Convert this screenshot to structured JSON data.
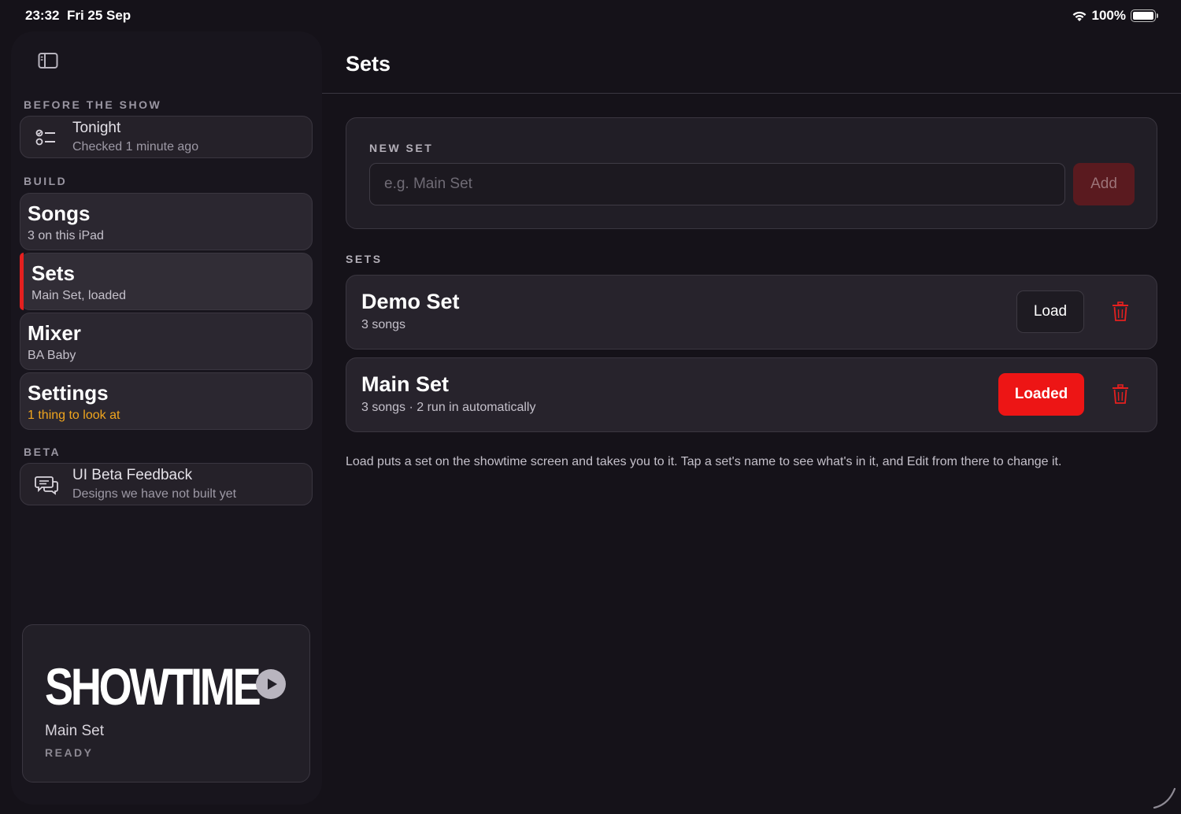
{
  "status_bar": {
    "time": "23:32",
    "date": "Fri 25 Sep",
    "battery": "100%",
    "wifi_icon": "wifi-icon",
    "battery_icon": "battery-icon"
  },
  "sidebar": {
    "toggle_icon": "sidebar-toggle-icon",
    "sections": {
      "before_show": "BEFORE THE SHOW",
      "build": "BUILD",
      "beta": "BETA"
    },
    "tonight": {
      "title": "Tonight",
      "subtitle": "Checked 1 minute ago",
      "icon": "checklist-icon"
    },
    "nav_items": [
      {
        "title": "Songs",
        "subtitle": "3 on this iPad"
      },
      {
        "title": "Sets",
        "subtitle": "Main Set, loaded",
        "active": true
      },
      {
        "title": "Mixer",
        "subtitle": "BA Baby"
      },
      {
        "title": "Settings",
        "subtitle": "1 thing to look at",
        "warning": true
      }
    ],
    "beta_feedback": {
      "title": "UI Beta Feedback",
      "subtitle": "Designs we have not built yet",
      "icon": "chat-bubbles-icon"
    },
    "showtime": {
      "label": "SHOWTIME",
      "set_name": "Main Set",
      "status": "READY",
      "play_icon": "play-icon"
    }
  },
  "main": {
    "title": "Sets",
    "new_set": {
      "label": "NEW SET",
      "placeholder": "e.g. Main Set",
      "value": "",
      "add_label": "Add"
    },
    "sets_label": "SETS",
    "sets": [
      {
        "name": "Demo Set",
        "subtitle": "3 songs",
        "button": "Load",
        "loaded": false
      },
      {
        "name": "Main Set",
        "subtitle": "3 songs · 2 run in automatically",
        "button": "Loaded",
        "loaded": true
      }
    ],
    "help_text": "Load puts a set on the showtime screen and takes you to it. Tap a set's name to see what's in it, and Edit from there to change it."
  },
  "colors": {
    "background": "#151219",
    "accent_red": "#ed1515",
    "warning": "#f0a51e",
    "card": "#27232c"
  }
}
